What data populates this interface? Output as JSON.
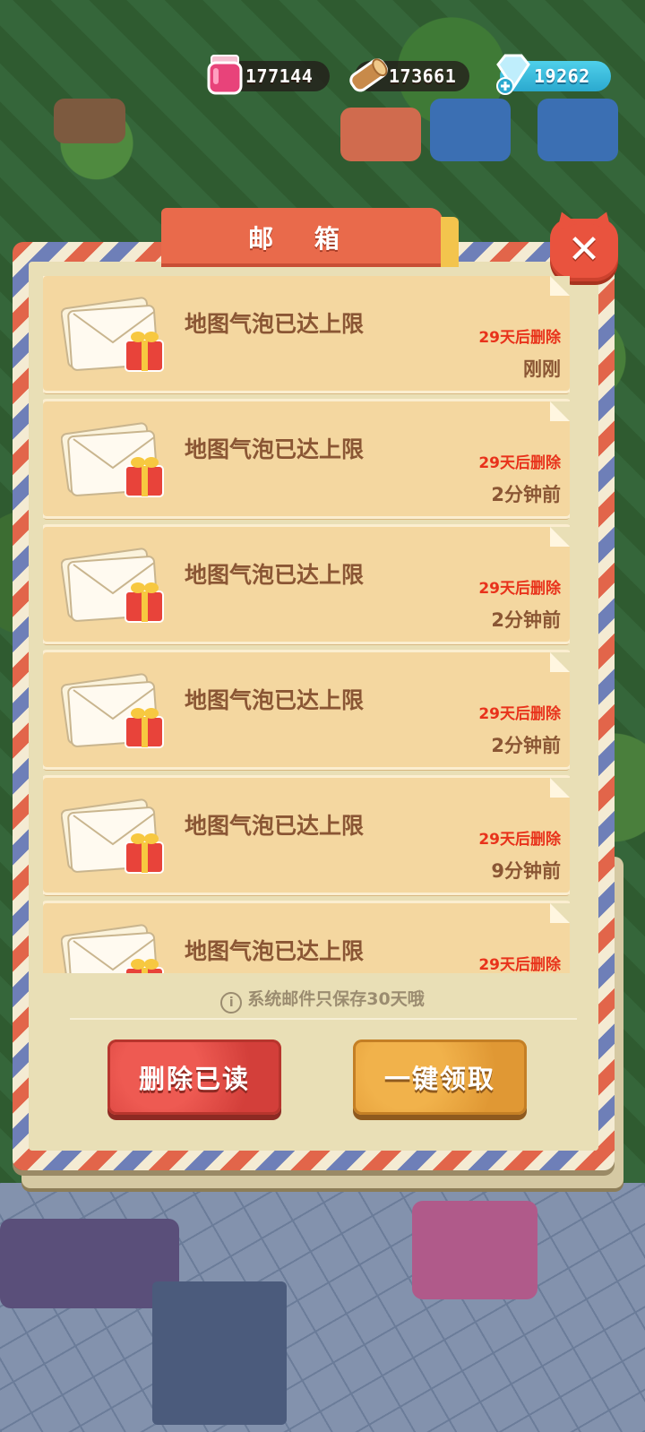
{
  "resources": {
    "jam": {
      "value": "177144",
      "icon": "jam-jar-icon"
    },
    "wood": {
      "value": "173661",
      "icon": "wood-log-icon"
    },
    "gems": {
      "value": "19262",
      "icon": "diamond-plus-icon"
    }
  },
  "mailbox": {
    "title": "邮 箱",
    "close_icon": "close-icon",
    "mails": [
      {
        "title": "地图气泡已达上限",
        "expire": "29天后删除",
        "time": "刚刚"
      },
      {
        "title": "地图气泡已达上限",
        "expire": "29天后删除",
        "time": "2分钟前"
      },
      {
        "title": "地图气泡已达上限",
        "expire": "29天后删除",
        "time": "2分钟前"
      },
      {
        "title": "地图气泡已达上限",
        "expire": "29天后删除",
        "time": "2分钟前"
      },
      {
        "title": "地图气泡已达上限",
        "expire": "29天后删除",
        "time": "9分钟前"
      },
      {
        "title": "地图气泡已达上限",
        "expire": "29天后删除",
        "time": ""
      }
    ],
    "notice": "系统邮件只保存30天哦",
    "delete_read_label": "删除已读",
    "collect_all_label": "一键领取"
  },
  "colors": {
    "accent_red": "#e96a4b",
    "expire_red": "#e8321b",
    "mail_bg": "#f4d7a0",
    "button_delete": "#d33f3a",
    "button_collect": "#e09834"
  }
}
